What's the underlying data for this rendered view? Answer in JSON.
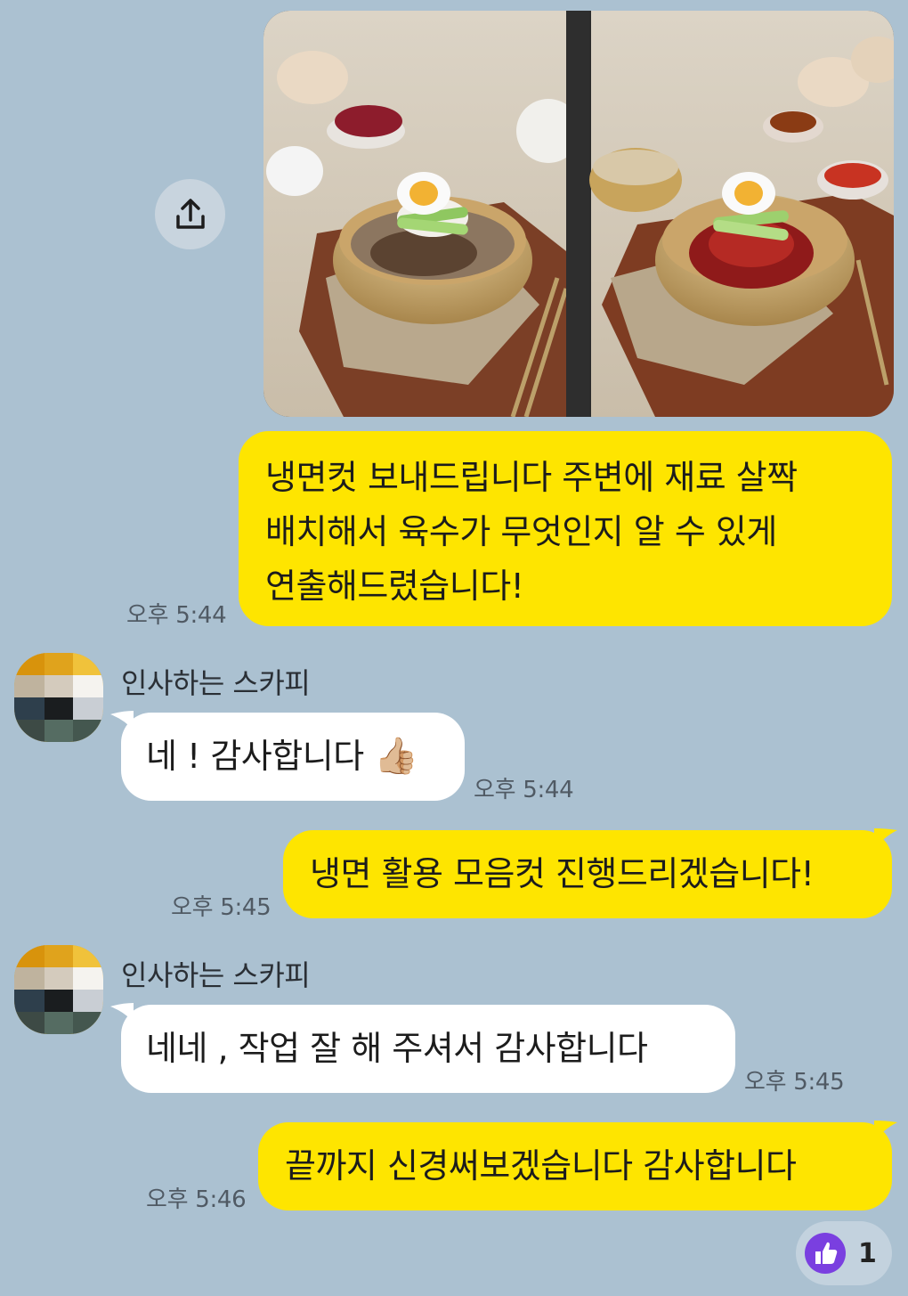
{
  "chat": {
    "photo_message": {
      "time": ""
    },
    "messages": [
      {
        "lines": [
          "냉면컷 보내드립니다 주변에 재료 살짝",
          "배치해서 육수가 무엇인지 알 수 있게",
          "연출해드렸습니다!"
        ],
        "time": "오후 5:44"
      },
      {
        "sender": "인사하는 스카피",
        "text": "네 ! 감사합니다",
        "emoji": "👍🏼",
        "time": "오후 5:44"
      },
      {
        "text": "냉면 활용 모음컷 진행드리겠습니다!",
        "time": "오후 5:45"
      },
      {
        "sender": "인사하는 스카피",
        "text": "네네 , 작업 잘 해 주셔서 감사합니다",
        "time": "오후 5:45"
      },
      {
        "text": "끝까지 신경써보겠습니다 감사합니다",
        "time": "오후 5:46"
      }
    ]
  },
  "reaction": {
    "icon": "thumbs-up-icon",
    "count": "1",
    "color": "#7a3fe0"
  },
  "colors": {
    "background": "#abc1d1",
    "my_bubble": "#fee500",
    "their_bubble": "#ffffff"
  }
}
